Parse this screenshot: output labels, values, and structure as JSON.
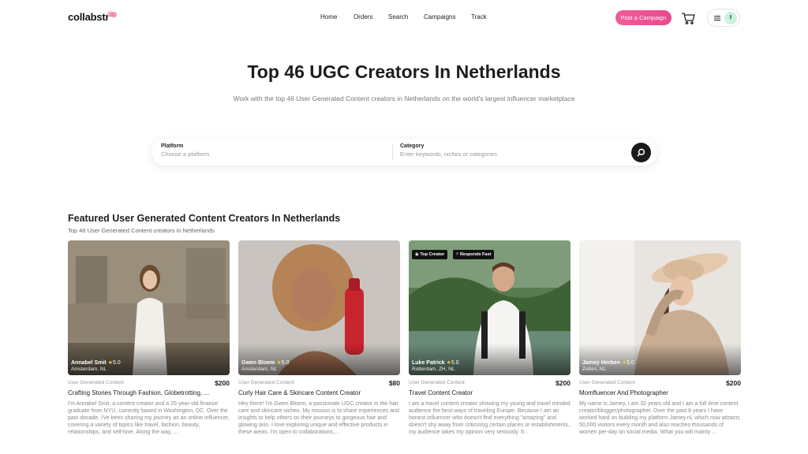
{
  "header": {
    "logo": "collabstr",
    "nav": [
      "Home",
      "Orders",
      "Search",
      "Campaigns",
      "Track"
    ],
    "post_campaign": "Post a Campaign",
    "avatar_initial": "I",
    "brand_color": "#e64a8d"
  },
  "hero": {
    "title": "Top 46 UGC Creators In Netherlands",
    "subtitle": "Work with the top 46 User Generated Content creators in Netherlands on the world's largest influencer marketplace"
  },
  "search": {
    "platform_label": "Platform",
    "platform_placeholder": "Choose a platform",
    "category_label": "Category",
    "category_placeholder": "Enter keywords, niches or categories"
  },
  "section": {
    "title": "Featured User Generated Content Creators In Netherlands",
    "subtitle": "Top 46 User Generated Content creators in Netherlands"
  },
  "creators": [
    {
      "name": "Annabel Smit",
      "rating": "5.0",
      "location": "Amsterdam, NL",
      "badges": [],
      "category": "User Generated Content",
      "price": "$200",
      "title": "Crafting Stories Through Fashion, Globetrotting, ...",
      "description": "I'm Annabel Smit, a content creator and a 25-year-old finance graduate from NYU, currently based in Washington, DC. Over the past decade, I've been sharing my journey as an online influencer, covering a variety of topics like travel, fashion, beauty, relationships, and self-love. Along the way, ..."
    },
    {
      "name": "Gwen Bloem",
      "rating": "5.0",
      "location": "Amsterdam, NL",
      "badges": [],
      "category": "User Generated Content",
      "price": "$80",
      "title": "Curly Hair Care & Skincare Content Creator",
      "description": "Hey there! I'm Gwen Bloem, a passionate UGC creator in the hair care and skincare niches. My mission is to share experiences and insights to help others on their journeys to gorgeous hair and glowing skin. I love exploring unique and effective products in these areas. I'm open to collaborations,..."
    },
    {
      "name": "Luke Patrick",
      "rating": "5.0",
      "location": "Rotterdam, ZH, NL",
      "badges": [
        "Top Creator",
        "Responds Fast"
      ],
      "category": "User Generated Content",
      "price": "$200",
      "title": "Travel Content Creator",
      "description": "I am a travel content creator showing my young and travel minded audience the best ways of traveling Europe. Because I am an honest influencer who doesn't find everything \"amazing\" and doesn't shy away from criticizing certain places or establishments, my audience takes my opinion very seriously. 6..."
    },
    {
      "name": "Jamey Herben",
      "rating": "5.0",
      "location": "Zelten, NL",
      "badges": [],
      "category": "User Generated Content",
      "price": "$200",
      "title": "Momfluencer And Photographer",
      "description": "My name is Jamey, I am 32 years old and I am a full time content creator/blogger/photographer. Over the past 8 years I have worked hard on building my platform Jamey.nl, which now attracts 50,000 visitors every month and also reaches thousands of women per-day on social media. What you will mainly ..."
    }
  ]
}
